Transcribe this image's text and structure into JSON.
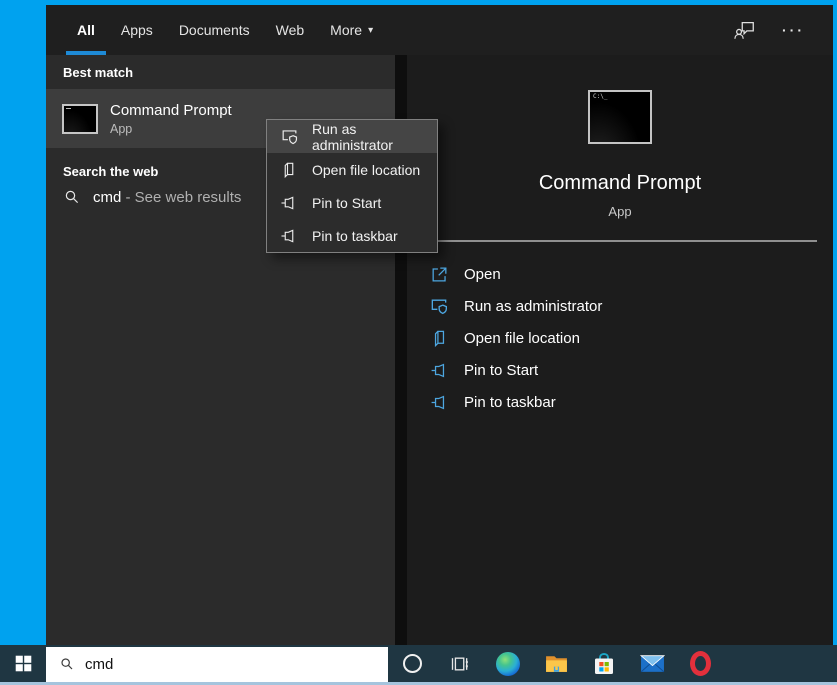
{
  "header": {
    "tabs": [
      {
        "label": "All",
        "active": true
      },
      {
        "label": "Apps",
        "active": false
      },
      {
        "label": "Documents",
        "active": false
      },
      {
        "label": "Web",
        "active": false
      },
      {
        "label": "More",
        "active": false
      }
    ],
    "more_chevron": "▾",
    "more_options_glyph": "···"
  },
  "left_panel": {
    "best_match_label": "Best match",
    "best_match": {
      "title": "Command Prompt",
      "subtitle": "App"
    },
    "search_web_label": "Search the web",
    "web_result": {
      "query": "cmd",
      "suffix": "- See web results"
    }
  },
  "context_menu": {
    "items": [
      {
        "label": "Run as administrator",
        "icon": "run-as-administrator-icon",
        "highlighted": true
      },
      {
        "label": "Open file location",
        "icon": "open-file-location-icon",
        "highlighted": false
      },
      {
        "label": "Pin to Start",
        "icon": "pin-icon",
        "highlighted": false
      },
      {
        "label": "Pin to taskbar",
        "icon": "pin-icon",
        "highlighted": false
      }
    ]
  },
  "preview": {
    "title": "Command Prompt",
    "subtitle": "App",
    "actions": [
      {
        "label": "Open",
        "icon": "open-icon"
      },
      {
        "label": "Run as administrator",
        "icon": "run-as-administrator-icon"
      },
      {
        "label": "Open file location",
        "icon": "open-file-location-icon"
      },
      {
        "label": "Pin to Start",
        "icon": "pin-icon"
      },
      {
        "label": "Pin to taskbar",
        "icon": "pin-icon"
      }
    ]
  },
  "taskbar": {
    "search_value": "cmd",
    "icons": [
      "start",
      "cortana",
      "task-view",
      "edge",
      "file-explorer",
      "microsoft-store",
      "mail",
      "opera"
    ]
  },
  "colors": {
    "desktop_blue": "#00a2ef",
    "tab_underline": "#1e8ad6",
    "action_icon_blue": "#4da6e0",
    "taskbar_bg": "#1f3642",
    "left_panel_bg": "#2b2b2b",
    "right_panel_bg": "#1c1c1c",
    "selected_row_bg": "#3d3d3d",
    "menu_highlight_bg": "#454545"
  }
}
